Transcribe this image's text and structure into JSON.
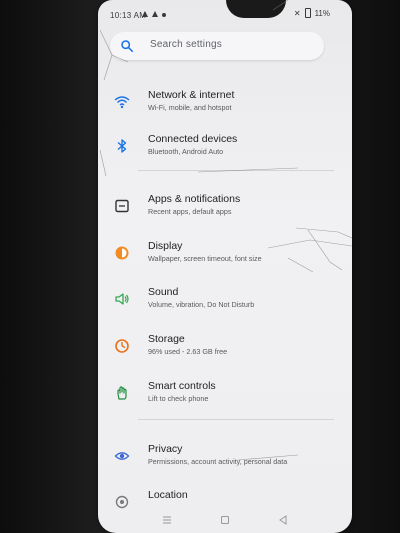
{
  "status": {
    "time": "10:13 AM",
    "battery": "11%"
  },
  "search": {
    "placeholder": "Search settings"
  },
  "items": [
    {
      "title": "Network & internet",
      "subtitle": "Wi-Fi, mobile, and hotspot",
      "icon": "wifi-icon"
    },
    {
      "title": "Connected devices",
      "subtitle": "Bluetooth, Android Auto",
      "icon": "bluetooth-icon"
    },
    {
      "title": "Apps & notifications",
      "subtitle": "Recent apps, default apps",
      "icon": "apps-icon"
    },
    {
      "title": "Display",
      "subtitle": "Wallpaper, screen timeout, font size",
      "icon": "display-icon"
    },
    {
      "title": "Sound",
      "subtitle": "Volume, vibration, Do Not Disturb",
      "icon": "volume-icon"
    },
    {
      "title": "Storage",
      "subtitle": "96% used - 2.63 GB free",
      "icon": "storage-icon"
    },
    {
      "title": "Smart controls",
      "subtitle": "Lift to check phone",
      "icon": "hand-icon"
    },
    {
      "title": "Privacy",
      "subtitle": "Permissions, account activity, personal data",
      "icon": "privacy-icon"
    },
    {
      "title": "Location",
      "subtitle": "",
      "icon": "location-icon"
    }
  ],
  "colors": {
    "accent_blue": "#1a73e8",
    "display_orange": "#f28b21",
    "storage_orange": "#e8711a",
    "sound_green": "#34a853",
    "smart_green": "#1e8e3e",
    "privacy_blue": "#3b67d6",
    "location_grey": "#7a7a7a"
  }
}
